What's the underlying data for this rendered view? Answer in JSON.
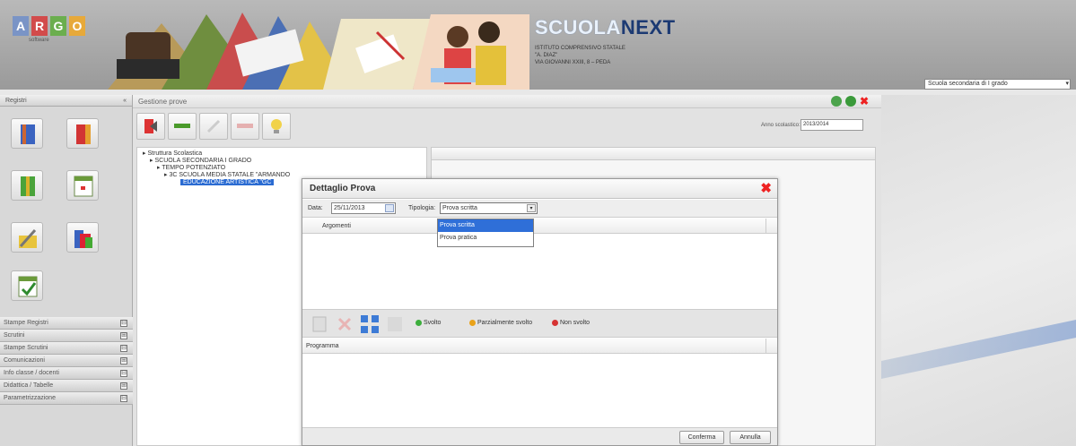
{
  "header": {
    "logo_letters": [
      "A",
      "R",
      "G",
      "O"
    ],
    "logo_sub": "software",
    "brand_a": "SCUOLA",
    "brand_b": "NEXT",
    "school_line1": "ISTITUTO COMPRENSIVO STATALE",
    "school_line2": "\"A. DIAZ\"",
    "school_line3": "VIA GIOVANNI XXIII, 8 – PEDA",
    "school_select": "Scuola secondaria di I grado"
  },
  "sidebar": {
    "title": "Registri",
    "menu": [
      {
        "label": "Stampe Registri",
        "toggle": "⊟"
      },
      {
        "label": "Scrutini",
        "toggle": "⊞"
      },
      {
        "label": "Stampe Scrutini",
        "toggle": "⊟"
      },
      {
        "label": "Comunicazioni",
        "toggle": "⊞"
      },
      {
        "label": "Info classe / docenti",
        "toggle": "⊟"
      },
      {
        "label": "Didattica / Tabelle",
        "toggle": "⊞"
      },
      {
        "label": "Parametrizzazione",
        "toggle": "⊟"
      }
    ]
  },
  "main": {
    "title": "Gestione prove",
    "anno_label": "Anno scolastico:",
    "anno_value": "2013/2014",
    "tree": [
      "Struttura Scolastica",
      "SCUOLA SECONDARIA I GRADO",
      "TEMPO POTENZIATO",
      "3C SCUOLA MEDIA STATALE \"ARMANDO",
      "EDUCAZIONE ARTISTICA \"GC"
    ]
  },
  "modal": {
    "title": "Dettaglio Prova",
    "date_label": "Data:",
    "date_value": "25/11/2013",
    "tipologia_label": "Tipologia:",
    "tipologia_value": "Prova scritta",
    "options": [
      "Prova scritta",
      "Prova pratica"
    ],
    "argomenti_header": "Argomenti",
    "legend": [
      {
        "label": "Svolto",
        "color": "#3cae3c"
      },
      {
        "label": "Parzialmente svolto",
        "color": "#e9a21a"
      },
      {
        "label": "Non svolto",
        "color": "#d63333"
      }
    ],
    "programma_header": "Programma",
    "confirm": "Conferma",
    "cancel": "Annulla"
  }
}
